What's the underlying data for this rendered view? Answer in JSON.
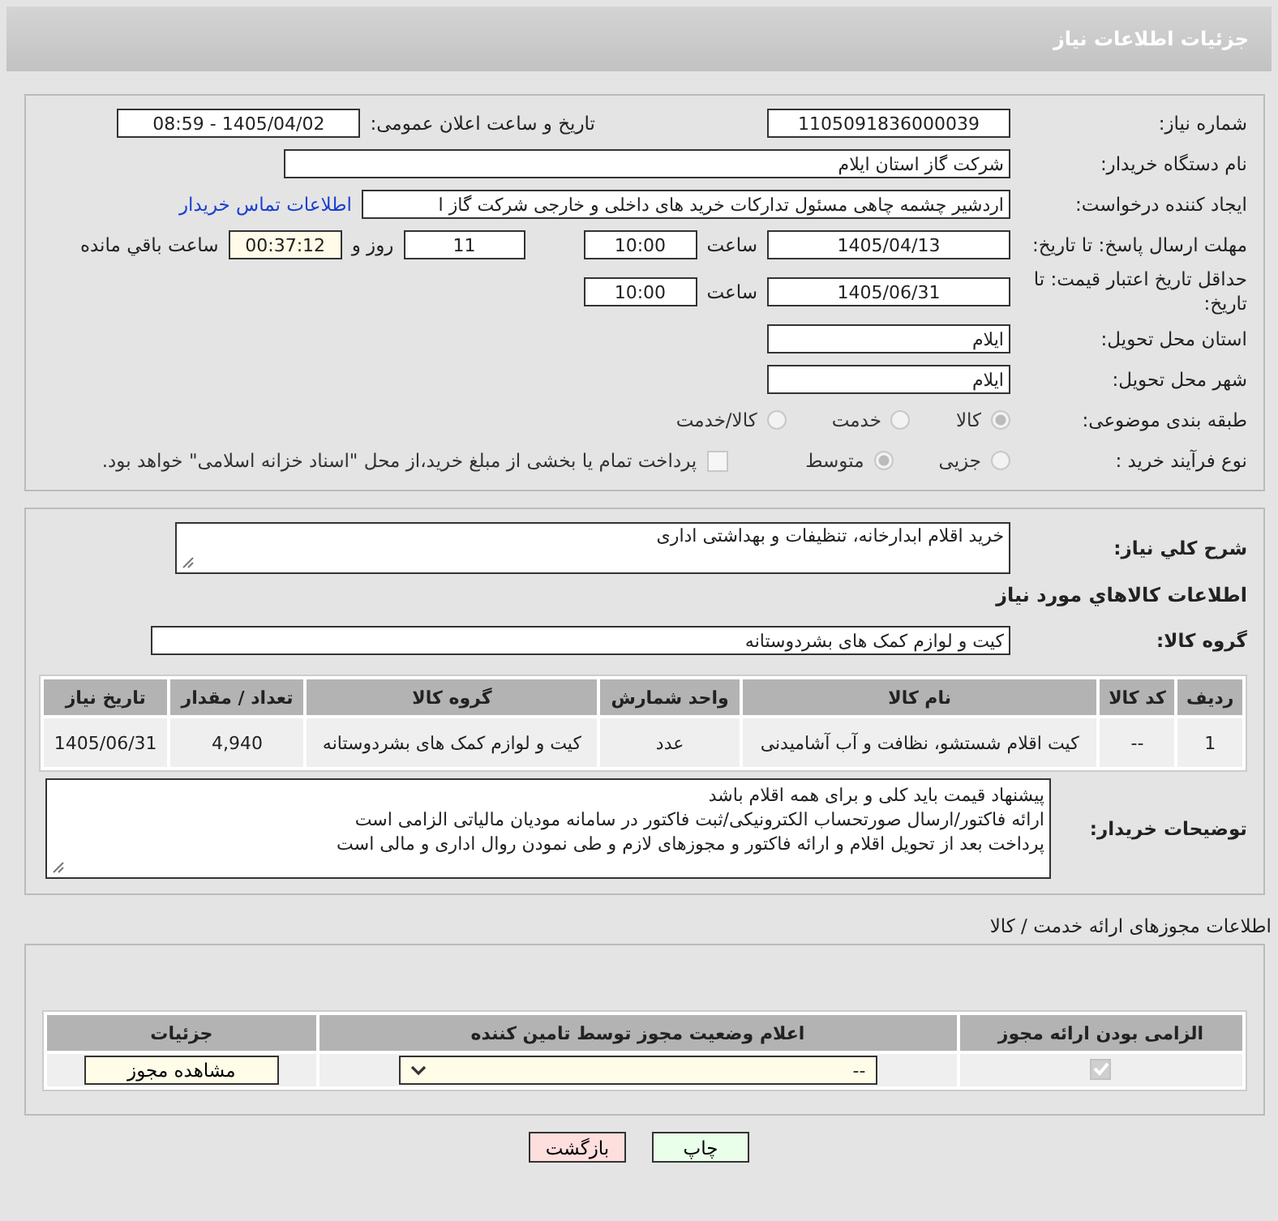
{
  "header": {
    "title": "جزئیات اطلاعات نیاز"
  },
  "need_number": {
    "label": "شماره نیاز:",
    "value": "1105091836000039"
  },
  "announce": {
    "label": "تاریخ و ساعت اعلان عمومی:",
    "value": "1405/04/02 - 08:59"
  },
  "buyer_org": {
    "label": "نام دستگاه خریدار:",
    "value": "شرکت گاز استان ایلام"
  },
  "creator": {
    "label": "ایجاد کننده درخواست:",
    "value": "اردشیر چشمه چاهی مسئول تدارکات خرید های داخلی و خارجی  شرکت گاز ا",
    "link": "اطلاعات تماس خریدار"
  },
  "deadline": {
    "label": "مهلت ارسال پاسخ: تا تاریخ:",
    "date": "1405/04/13",
    "time_label": "ساعت",
    "time": "10:00",
    "days": "11",
    "days_label": "روز و",
    "remaining": "00:37:12",
    "remaining_label": "ساعت باقي مانده"
  },
  "validity": {
    "label": "حداقل تاریخ اعتبار قیمت: تا تاریخ:",
    "date": "1405/06/31",
    "time_label": "ساعت",
    "time": "10:00"
  },
  "province": {
    "label": "استان محل تحویل:",
    "value": "ایلام"
  },
  "city": {
    "label": "شهر محل تحویل:",
    "value": "ایلام"
  },
  "category": {
    "label": "طبقه بندی موضوعی:",
    "options": [
      {
        "label": "کالا",
        "selected": true
      },
      {
        "label": "خدمت",
        "selected": false
      },
      {
        "label": "کالا/خدمت",
        "selected": false
      }
    ]
  },
  "process": {
    "label": "نوع فرآیند خرید :",
    "options": [
      {
        "label": "جزیی",
        "selected": false
      },
      {
        "label": "متوسط",
        "selected": true
      }
    ],
    "payment": {
      "checked": false,
      "label": "پرداخت تمام یا بخشی از مبلغ خرید،از محل \"اسناد خزانه اسلامی\" خواهد بود."
    }
  },
  "summary": {
    "label": "شرح کلي نياز:",
    "value": "خرید اقلام ابدارخانه، تنظیفات و بهداشتی اداری"
  },
  "goods": {
    "title": "اطلاعات کالاهاي مورد نياز",
    "group_label": "گروه کالا:",
    "group_value": "کیت و لوازم کمک های بشردوستانه",
    "columns": [
      "ردیف",
      "کد کالا",
      "نام کالا",
      "واحد شمارش",
      "گروه کالا",
      "تعداد / مقدار",
      "تاریخ نیاز"
    ],
    "rows": [
      [
        "1",
        "--",
        "کیت اقلام شستشو، نظافت و آب آشامیدنی",
        "عدد",
        "کیت و لوازم کمک های بشردوستانه",
        "4,940",
        "1405/06/31"
      ]
    ]
  },
  "buyer_notes": {
    "label": "توضیحات خریدار:",
    "lines": [
      "پیشنهاد قیمت باید کلی و برای همه اقلام باشد",
      "ارائه فاکتور/ارسال صورتحساب الکترونیکی/ثبت فاکتور در سامانه مودیان مالیاتی الزامی است",
      "پرداخت بعد از تحویل اقلام و ارائه فاکتور و مجوزهای لازم و طی نمودن روال اداری و مالی است"
    ]
  },
  "permits": {
    "title": "اطلاعات مجوزهای ارائه خدمت / کالا",
    "columns": [
      "الزامی بودن ارائه مجوز",
      "اعلام وضعیت مجوز توسط تامین کننده",
      "جزئیات"
    ],
    "rows": [
      {
        "required": true,
        "status": "--",
        "action": "مشاهده مجوز"
      }
    ]
  },
  "buttons": [
    {
      "label": "چاپ",
      "kind": "print"
    },
    {
      "label": "بازگشت",
      "kind": "back"
    }
  ]
}
